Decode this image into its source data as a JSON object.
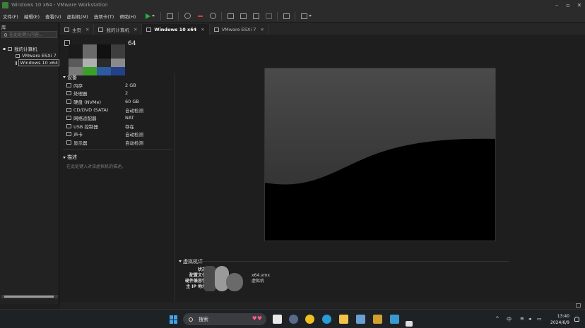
{
  "window": {
    "title": "Windows 10 x64 - VMware Workstation",
    "controls": {
      "minimize": "–",
      "restore": "▫",
      "close": "✕"
    }
  },
  "menu": [
    "文件(F)",
    "编辑(E)",
    "查看(V)",
    "虚拟机(M)",
    "选项卡(T)",
    "帮助(H)"
  ],
  "sidebar": {
    "title": "库",
    "search_placeholder": "在此处键入内容...",
    "root": "我的计算机",
    "items": [
      "VMware ESXi 7",
      "Windows 10 x64"
    ]
  },
  "tabs": [
    {
      "label": "主页",
      "active": false
    },
    {
      "label": "我的计算机",
      "active": false
    },
    {
      "label": "Windows 10 x64",
      "active": true
    },
    {
      "label": "VMware ESXi 7",
      "active": false
    }
  ],
  "vm": {
    "title_suffix": "64",
    "devices_header": "设备",
    "devices": [
      {
        "name": "内存",
        "value": "2 GB",
        "icon": "memory-icon"
      },
      {
        "name": "处理器",
        "value": "2",
        "icon": "cpu-icon"
      },
      {
        "name": "硬盘 (NVMe)",
        "value": "60 GB",
        "icon": "disk-icon"
      },
      {
        "name": "CD/DVD (SATA)",
        "value": "自动检测",
        "icon": "cd-icon"
      },
      {
        "name": "网络适配器",
        "value": "NAT",
        "icon": "network-icon"
      },
      {
        "name": "USB 控制器",
        "value": "存在",
        "icon": "usb-icon"
      },
      {
        "name": "声卡",
        "value": "自动检测",
        "icon": "sound-icon"
      },
      {
        "name": "显示器",
        "value": "自动检测",
        "icon": "monitor-icon"
      }
    ],
    "description_header": "描述",
    "description_placeholder": "在此处键入对该虚拟机的描述。",
    "details_header": "虚拟机详",
    "details": [
      {
        "label": "状态",
        "value": ""
      },
      {
        "label": "配置文件",
        "value": "x64.vmx"
      },
      {
        "label": "硬件兼容性",
        "value": "虚拟机"
      },
      {
        "label": "主 IP 地址",
        "value": "网"
      }
    ]
  },
  "taskbar": {
    "search_label": "搜索",
    "tray_ime": "中",
    "time": "13:40",
    "date": "2024/6/9"
  },
  "colors": {
    "background": "#1e1e1e",
    "play_green": "#27b03a",
    "accent_blue": "#3da4f0"
  }
}
